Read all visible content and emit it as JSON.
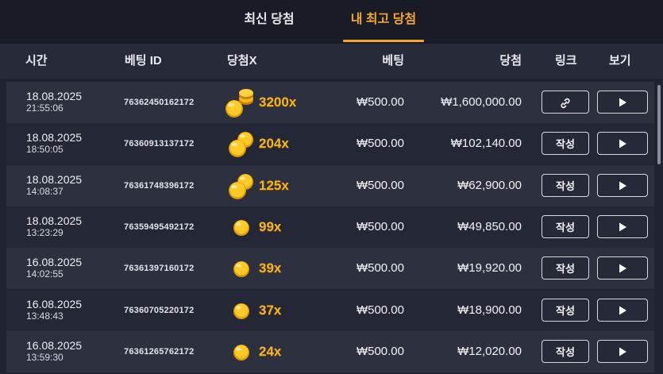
{
  "tabs": [
    {
      "label": "최신 당첨",
      "active": false
    },
    {
      "label": "내 최고 당첨",
      "active": true
    }
  ],
  "columns": {
    "time": "시간",
    "bet_id": "베팅 ID",
    "multiplier": "당첨X",
    "bet": "베팅",
    "win": "당첨",
    "link": "링크",
    "view": "보기"
  },
  "colors": {
    "accent": "#f6a91f",
    "background": "#1f2230",
    "row_odd": "#2c303f",
    "row_even": "#242735",
    "multiplier_text": "#f5b51d"
  },
  "rows": [
    {
      "date": "18.08.2025",
      "time": "21:55:06",
      "bet_id": "76362450162172",
      "coins": "large-stack",
      "multiplier": "3200x",
      "bet": "₩500.00",
      "win": "₩1,600,000.00",
      "link_icon": "link-icon",
      "link_label": "",
      "view_icon": "play-icon"
    },
    {
      "date": "18.08.2025",
      "time": "18:50:05",
      "bet_id": "76360913137172",
      "coins": "double",
      "multiplier": "204x",
      "bet": "₩500.00",
      "win": "₩102,140.00",
      "link_icon": "",
      "link_label": "작성",
      "view_icon": "play-icon"
    },
    {
      "date": "18.08.2025",
      "time": "14:08:37",
      "bet_id": "76361748396172",
      "coins": "double",
      "multiplier": "125x",
      "bet": "₩500.00",
      "win": "₩62,900.00",
      "link_icon": "",
      "link_label": "작성",
      "view_icon": "play-icon"
    },
    {
      "date": "18.08.2025",
      "time": "13:23:29",
      "bet_id": "76359495492172",
      "coins": "single",
      "multiplier": "99x",
      "bet": "₩500.00",
      "win": "₩49,850.00",
      "link_icon": "",
      "link_label": "작성",
      "view_icon": "play-icon"
    },
    {
      "date": "16.08.2025",
      "time": "14:02:55",
      "bet_id": "76361397160172",
      "coins": "single",
      "multiplier": "39x",
      "bet": "₩500.00",
      "win": "₩19,920.00",
      "link_icon": "",
      "link_label": "작성",
      "view_icon": "play-icon"
    },
    {
      "date": "16.08.2025",
      "time": "13:48:43",
      "bet_id": "76360705220172",
      "coins": "single",
      "multiplier": "37x",
      "bet": "₩500.00",
      "win": "₩18,900.00",
      "link_icon": "",
      "link_label": "작성",
      "view_icon": "play-icon"
    },
    {
      "date": "16.08.2025",
      "time": "13:59:30",
      "bet_id": "76361265762172",
      "coins": "single",
      "multiplier": "24x",
      "bet": "₩500.00",
      "win": "₩12,020.00",
      "link_icon": "",
      "link_label": "작성",
      "view_icon": "play-icon"
    }
  ]
}
